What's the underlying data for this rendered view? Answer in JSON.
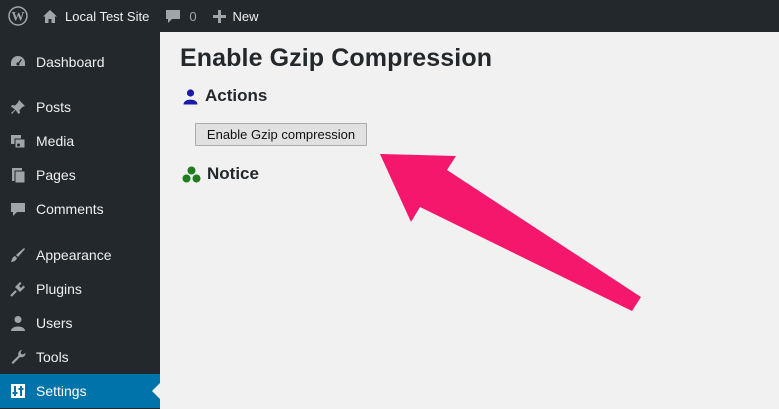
{
  "adminbar": {
    "site_name": "Local Test Site",
    "comments_count": "0",
    "new_label": "New"
  },
  "sidebar": {
    "items": [
      {
        "label": "Dashboard",
        "icon": "dashboard-icon"
      },
      {
        "label": "Posts",
        "icon": "pin-icon"
      },
      {
        "label": "Media",
        "icon": "media-icon"
      },
      {
        "label": "Pages",
        "icon": "pages-icon"
      },
      {
        "label": "Comments",
        "icon": "comment-icon"
      },
      {
        "label": "Appearance",
        "icon": "brush-icon"
      },
      {
        "label": "Plugins",
        "icon": "plug-icon"
      },
      {
        "label": "Users",
        "icon": "user-icon"
      },
      {
        "label": "Tools",
        "icon": "wrench-icon"
      },
      {
        "label": "Settings",
        "icon": "settings-icon",
        "current": true
      }
    ]
  },
  "main": {
    "title": "Enable Gzip Compression",
    "actions_heading": "Actions",
    "button_label": "Enable Gzip compression",
    "notice_heading": "Notice"
  },
  "colors": {
    "adminbar_bg": "#23282d",
    "current_menu_bg": "#0073aa",
    "actions_icon": "#1a1aaa",
    "notice_icon": "#1e7d1e",
    "annotation_arrow": "#f5176b"
  }
}
